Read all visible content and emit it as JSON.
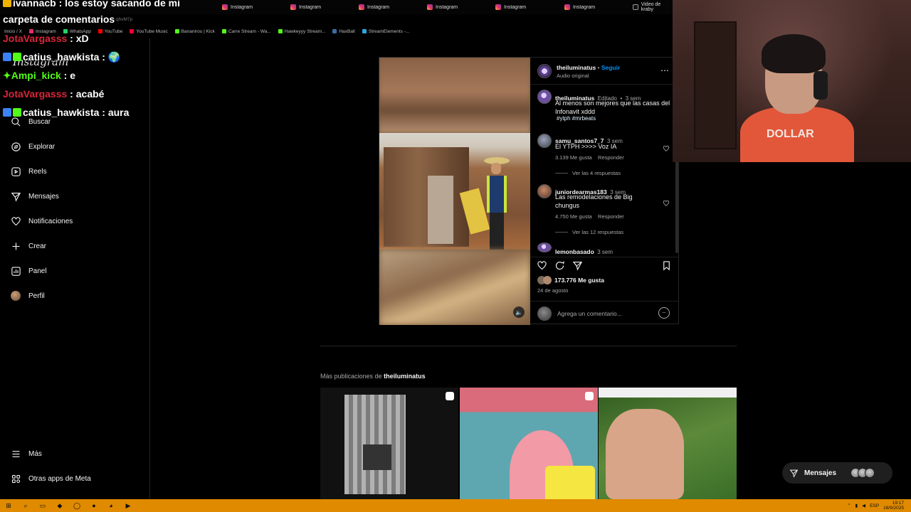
{
  "browser": {
    "tabs": [
      {
        "label": "Instagram",
        "x": 0
      },
      {
        "label": "Instagram",
        "x": 0
      },
      {
        "label": "Instagram",
        "x": 0
      },
      {
        "label": "Instagram",
        "x": 0
      },
      {
        "label": "Instagram",
        "x": 0
      },
      {
        "label": "Instagram",
        "x": 0
      },
      {
        "label": "Video de kraby",
        "x": 0
      }
    ],
    "url_fragment": "qhxM7p",
    "bookmarks": [
      "Inicio / X",
      "Instagram",
      "WhatsApp",
      "YouTube",
      "YouTube Music",
      "Bananirou | Kick",
      "Carre Stream - Wa...",
      "Hawkeyyy Stream...",
      "HaxBall",
      "StreamElements -..."
    ]
  },
  "chat": [
    {
      "user": "ivannacb",
      "sep": " : ",
      "msg": "los estoy sacando de mi",
      "color": "white"
    },
    {
      "user": "",
      "sep": "",
      "msg": "carpeta de comentarios",
      "color": "white"
    },
    {
      "user": "JotaVargasss",
      "sep": " : ",
      "msg": "xD",
      "color": "red"
    },
    {
      "user": "catius_hawkista",
      "sep": " : ",
      "msg": "🌍",
      "color": "white"
    },
    {
      "user": "Ampi_kick",
      "sep": " : ",
      "msg": "e",
      "color": "green"
    },
    {
      "user": "JotaVargasss",
      "sep": " : ",
      "msg": "acabé",
      "color": "red"
    },
    {
      "user": "catius_hawkista",
      "sep": " : ",
      "msg": "aura",
      "color": "white"
    }
  ],
  "sidebar": {
    "logo": "Instagram",
    "items": [
      {
        "label": "Buscar",
        "icon": "search-icon"
      },
      {
        "label": "Explorar",
        "icon": "compass-icon"
      },
      {
        "label": "Reels",
        "icon": "reels-icon"
      },
      {
        "label": "Mensajes",
        "icon": "send-icon"
      },
      {
        "label": "Notificaciones",
        "icon": "heart-icon"
      },
      {
        "label": "Crear",
        "icon": "plus-icon"
      },
      {
        "label": "Panel",
        "icon": "chart-icon"
      },
      {
        "label": "Perfil",
        "icon": "avatar-icon"
      }
    ],
    "more": "Más",
    "meta": "Otras apps de Meta"
  },
  "post": {
    "author": "theiluminatus",
    "follow": "Seguir",
    "bullet": "•",
    "audio": "Audio original",
    "caption": {
      "user": "theiluminatus",
      "edited": "Editado",
      "time": "3 sem",
      "text": "Al menos son mejores que las casas del Infonavit xddd",
      "tags": "#ytph #mrbeats"
    },
    "comments": [
      {
        "user": "samu_santos7_7",
        "time": "3 sem",
        "text": "El YTPH >>>> Voz IA",
        "likes": "3.139 Me gusta",
        "reply": "Responder",
        "replies": "Ver las 4 respuestas"
      },
      {
        "user": "juniordearmas183",
        "time": "3 sem",
        "text": "Las remodelaciones de Big chungus",
        "likes": "4.750 Me gusta",
        "reply": "Responder",
        "replies": "Ver las 12 respuestas"
      },
      {
        "user": "lemonbasado",
        "time": "3 sem"
      }
    ],
    "likes": "173.776 Me gusta",
    "date": "24 de agosto",
    "comment_placeholder": "Agrega un comentario..."
  },
  "more": {
    "prefix": "Más publicaciones de",
    "user": "theiluminatus"
  },
  "webcam": {
    "shirt_text": "DOLLAR"
  },
  "messages_pill": {
    "label": "Mensajes"
  },
  "taskbar": {
    "time": "19:17",
    "date": "16/9/2025",
    "lang": "ESP"
  }
}
